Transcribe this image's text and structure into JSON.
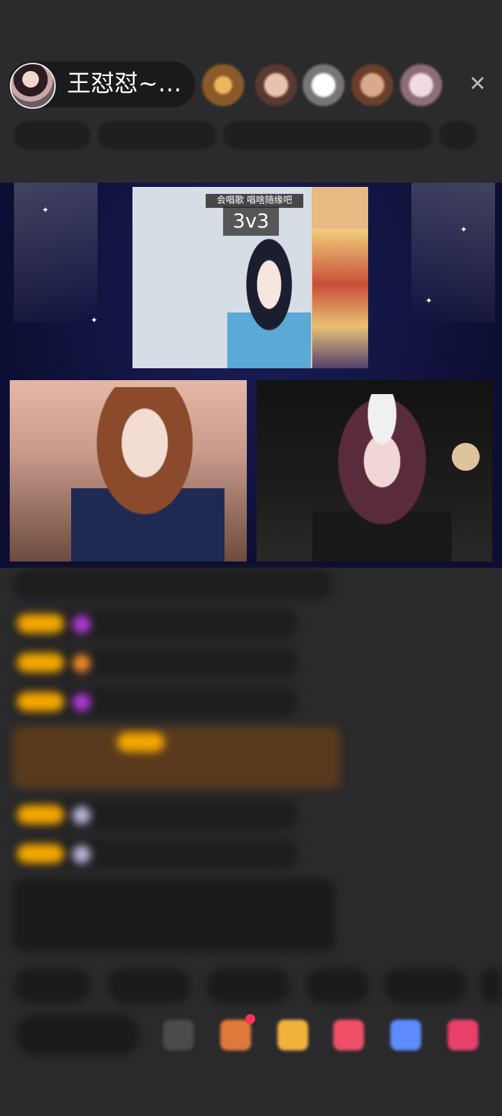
{
  "header": {
    "host_name": "王怼怼~…",
    "close_icon": "close-icon"
  },
  "stage": {
    "mode_tag": "会唱歌    唱啥随缘吧",
    "mode_score": "3v3"
  },
  "colors": {
    "background": "#2a2a2c",
    "badge": "#f2a600",
    "stage": "#0d0e33"
  }
}
